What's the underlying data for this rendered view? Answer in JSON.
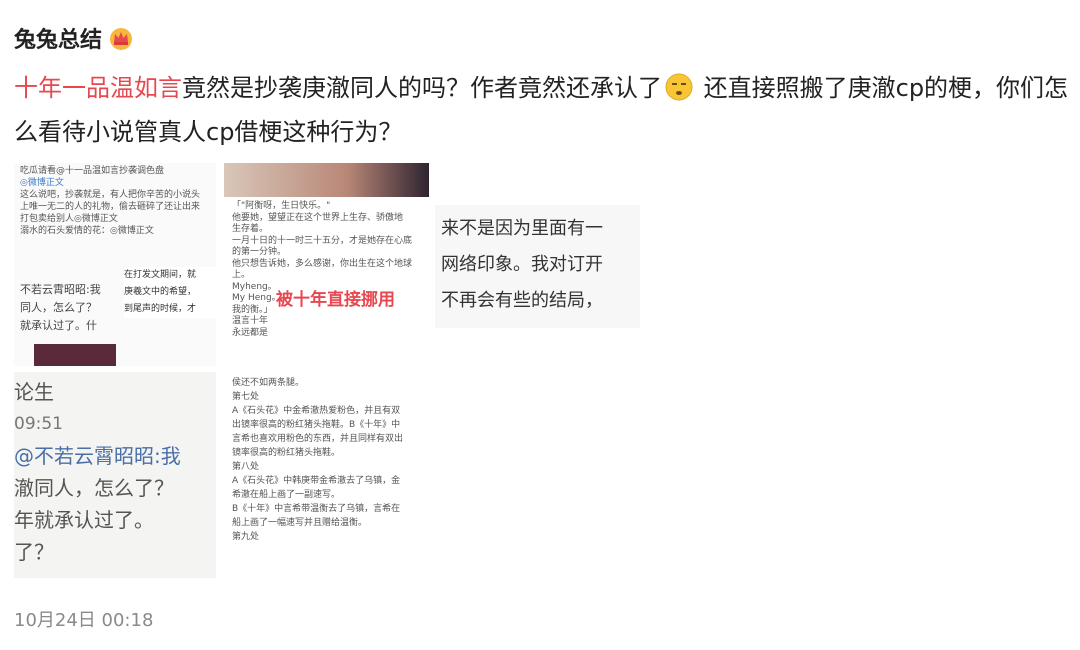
{
  "post": {
    "author": "兔兔总结",
    "crown_icon": "crown-icon",
    "hashtag": "十年一品温如言",
    "text_part1": "竟然是抄袭庚澈同人的吗？作者竟然还承认了",
    "emoji_icon": "dizzy-face-icon",
    "text_part2": " 还直接照搬了庚澈cp的梗，你们怎么看待小说管真人cp借梗这种行为？",
    "timestamp": "10月24日 00:18"
  },
  "images": {
    "img1": {
      "lines": [
        "吃瓜请看@十一品温如言抄袭调色盘",
        "◎微博正文",
        "这么说吧，抄袭就是，有人把你辛苦的小说头",
        "上唯一无二的人的礼物，偷去砸碎了还让出来",
        "打包卖给别人◎微博正文",
        "溺水的石头爱情的花：◎微博正文"
      ],
      "chat": [
        "不若云霄昭昭:我",
        "同人，怎么了？",
        "就承认过了。什"
      ],
      "side": [
        "在打发文期间，就",
        "庚羲文中的希望，",
        "到尾声的时候，才"
      ]
    },
    "img2": {
      "lines": [
        "「\"阿衡呀，生日快乐。\"",
        "他要她，望望正在这个世界上生存、骄傲地",
        "生存着。",
        "一月十日的十一时三十五分，才是她存在心底",
        "的第一分钟。",
        "他只想告诉她，多么感谢，你出生在这个地球",
        "上。",
        "Myheng。",
        "My Heng。",
        "我的衡。」",
        "温言十年",
        "永远都是"
      ],
      "overlay": "被十年直接挪用"
    },
    "img3": {
      "lines": [
        "侯还不如两条腿。",
        "第七处",
        "A《石头花》中金希澈热爱粉色，并且有双",
        "出镜率很高的粉红猪头拖鞋。B《十年》中",
        "言希也喜欢用粉色的东西，并且同样有双出",
        "镜率很高的粉红猪头拖鞋。",
        "第八处",
        "A《石头花》中韩庚带金希澈去了乌镇，金",
        "希澈在船上画了一副速写。",
        "B《十年》中言希带温衡去了乌镇，言希在",
        "船上画了一幅速写并且赠给温衡。",
        "第九处"
      ]
    },
    "img4": {
      "lines": [
        "论生",
        "09:51",
        "@不若云霄昭昭:我",
        "澈同人，怎么了？",
        "年就承认过了。",
        "了？"
      ]
    },
    "img5": {
      "lines": [
        "来不是因为里面有一",
        "网络印象。我对订开",
        "不再会有些的结局，"
      ]
    }
  }
}
